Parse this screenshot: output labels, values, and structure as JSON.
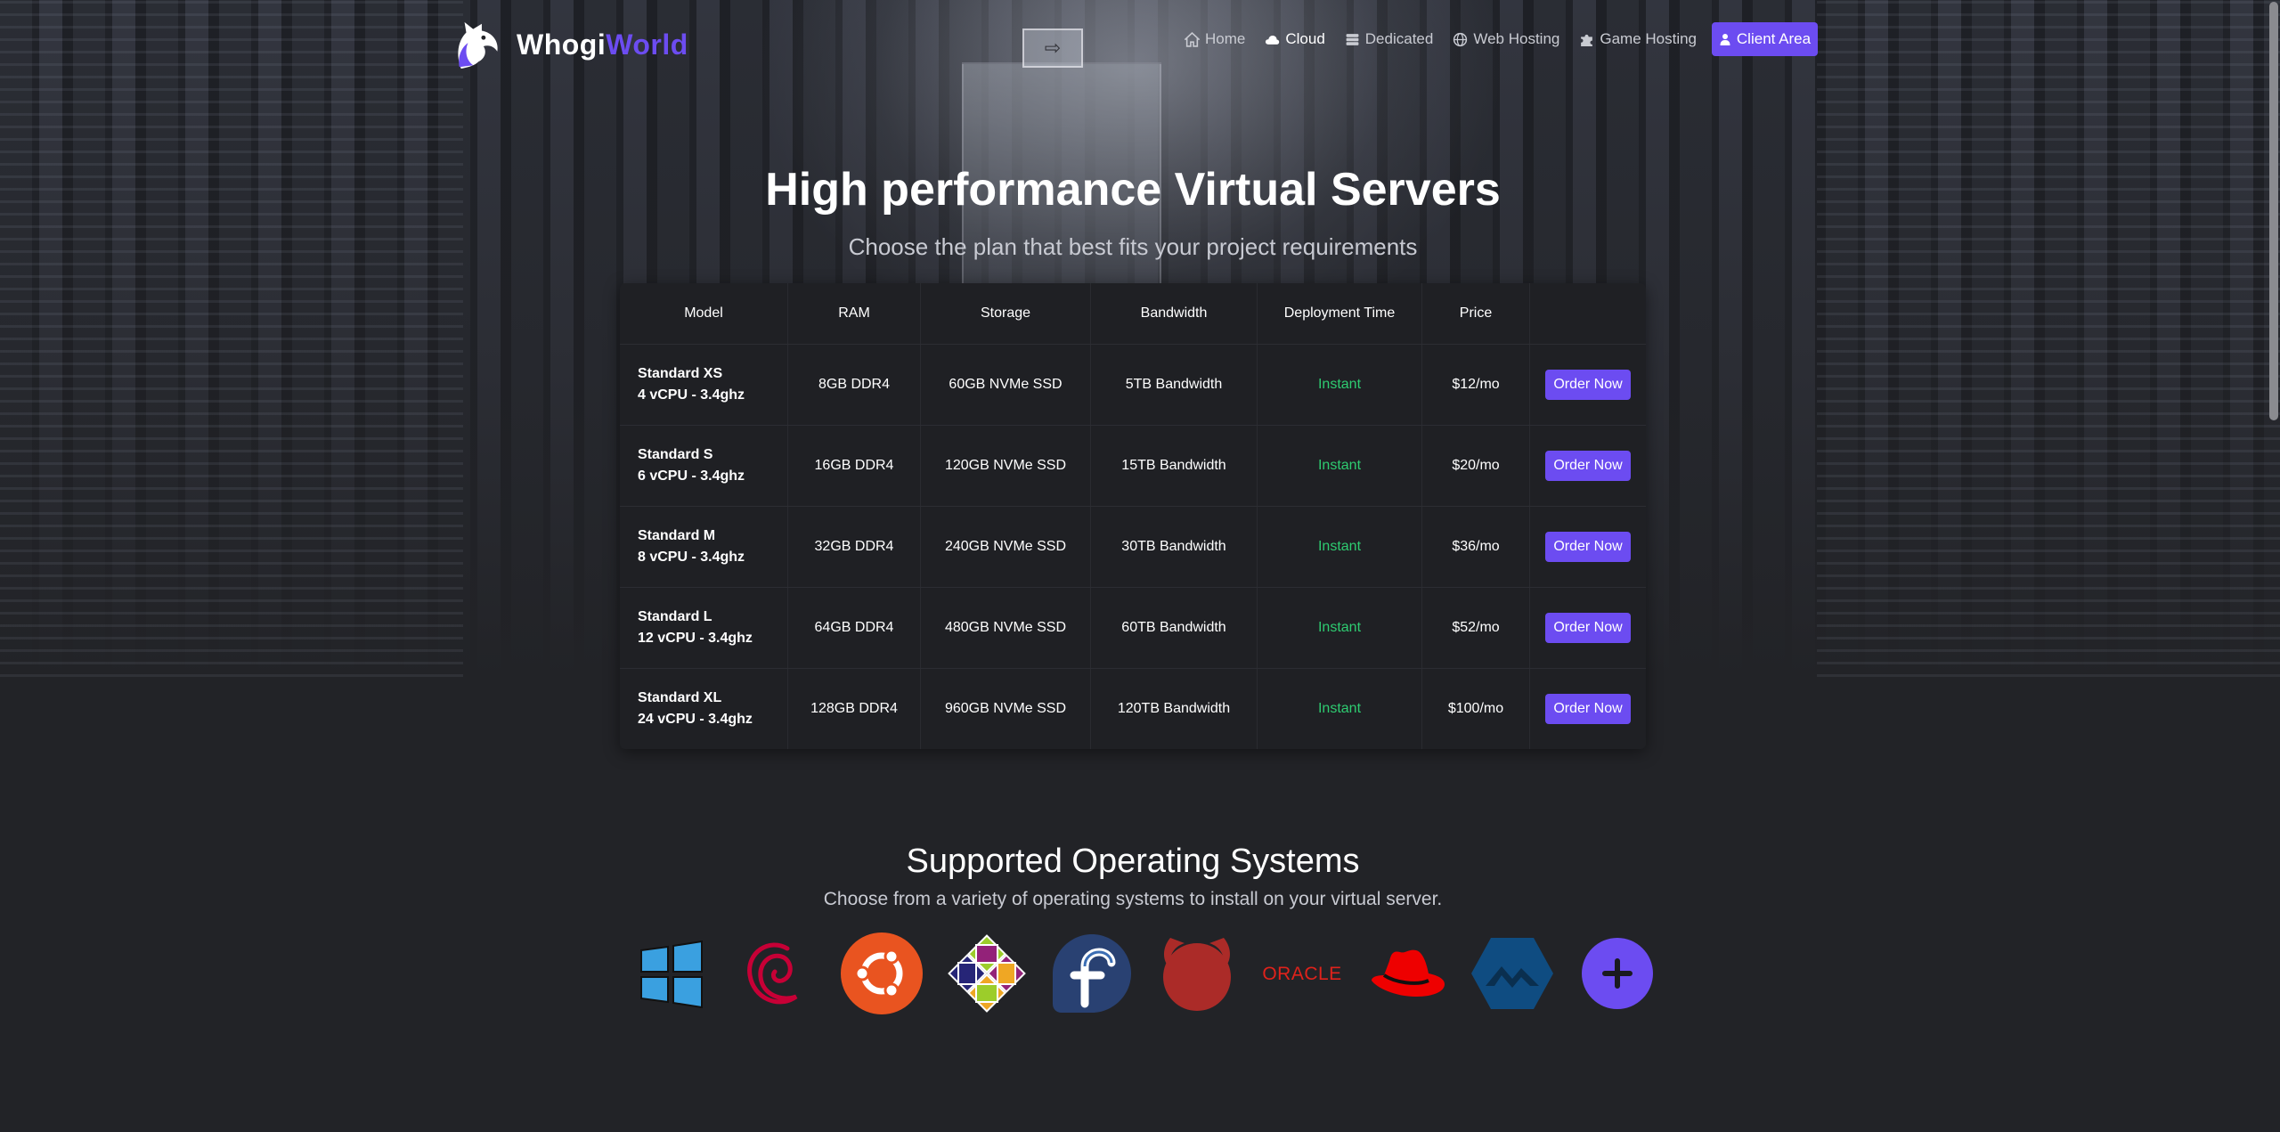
{
  "brand": {
    "part1": "Whogi",
    "part2": "World",
    "accent": "#6c4cf1"
  },
  "nav": {
    "items": [
      {
        "label": "Home",
        "icon": "home-icon"
      },
      {
        "label": "Cloud",
        "icon": "cloud-icon",
        "active": true
      },
      {
        "label": "Dedicated",
        "icon": "server-icon"
      },
      {
        "label": "Web Hosting",
        "icon": "globe-icon"
      },
      {
        "label": "Game Hosting",
        "icon": "puzzle-icon"
      }
    ],
    "client_area": "Client Area"
  },
  "hero": {
    "title": "High performance Virtual Servers",
    "subtitle": "Choose the plan that best fits your project requirements"
  },
  "plans": {
    "headers": [
      "Model",
      "RAM",
      "Storage",
      "Bandwidth",
      "Deployment Time",
      "Price",
      ""
    ],
    "rows": [
      {
        "name": "Standard XS",
        "cpu": "4 vCPU - 3.4ghz",
        "ram": "8GB DDR4",
        "storage": "60GB NVMe SSD",
        "bandwidth": "5TB Bandwidth",
        "deploy": "Instant",
        "price": "$12/mo",
        "order": "Order Now"
      },
      {
        "name": "Standard S",
        "cpu": "6 vCPU - 3.4ghz",
        "ram": "16GB DDR4",
        "storage": "120GB NVMe SSD",
        "bandwidth": "15TB Bandwidth",
        "deploy": "Instant",
        "price": "$20/mo",
        "order": "Order Now"
      },
      {
        "name": "Standard M",
        "cpu": "8 vCPU - 3.4ghz",
        "ram": "32GB DDR4",
        "storage": "240GB NVMe SSD",
        "bandwidth": "30TB Bandwidth",
        "deploy": "Instant",
        "price": "$36/mo",
        "order": "Order Now"
      },
      {
        "name": "Standard L",
        "cpu": "12 vCPU - 3.4ghz",
        "ram": "64GB DDR4",
        "storage": "480GB NVMe SSD",
        "bandwidth": "60TB Bandwidth",
        "deploy": "Instant",
        "price": "$52/mo",
        "order": "Order Now"
      },
      {
        "name": "Standard XL",
        "cpu": "24 vCPU - 3.4ghz",
        "ram": "128GB DDR4",
        "storage": "960GB NVMe SSD",
        "bandwidth": "120TB Bandwidth",
        "deploy": "Instant",
        "price": "$100/mo",
        "order": "Order Now"
      }
    ]
  },
  "os_section": {
    "title": "Supported Operating Systems",
    "subtitle": "Choose from a variety of operating systems to install on your virtual server.",
    "logos": [
      "windows-icon",
      "debian-icon",
      "ubuntu-icon",
      "centos-icon",
      "fedora-icon",
      "freebsd-icon",
      "oracle-icon",
      "redhat-icon",
      "almalinux-icon",
      "more-os-icon"
    ],
    "oracle_text": "ORACLE"
  },
  "colors": {
    "accent": "#6c4cf1",
    "instant": "#2ecc71",
    "background": "#222327"
  }
}
